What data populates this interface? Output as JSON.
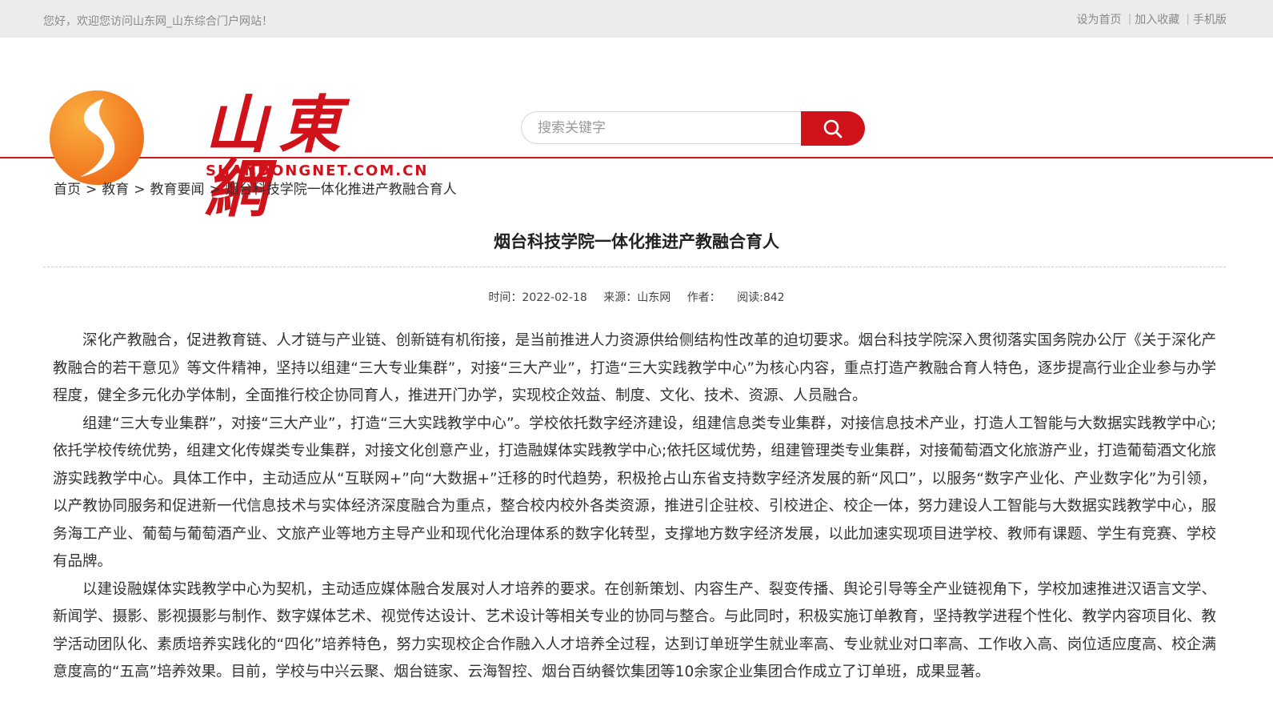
{
  "topbar": {
    "welcome": "您好，欢迎您访问山东网_山东综合门户网站！",
    "links": [
      "设为首页",
      "加入收藏",
      "手机版"
    ]
  },
  "logo": {
    "wordmark": "山東網",
    "domain": "SHANDONGNET.COM.CN",
    "colors": {
      "orange": "#f7941d",
      "red": "#d0121b"
    }
  },
  "search": {
    "placeholder": "搜索关键字",
    "button_icon": "search-icon"
  },
  "breadcrumb": [
    "首页",
    "教育",
    "教育要闻",
    "烟台科技学院一体化推进产教融合育人"
  ],
  "article": {
    "title": "烟台科技学院一体化推进产教融合育人",
    "meta": {
      "time": "时间：2022-02-18",
      "source": "来源：山东网",
      "author": "作者：",
      "reads": "阅读:842"
    },
    "paragraphs": [
      "深化产教融合，促进教育链、人才链与产业链、创新链有机衔接，是当前推进人力资源供给侧结构性改革的迫切要求。烟台科技学院深入贯彻落实国务院办公厅《关于深化产教融合的若干意见》等文件精神，坚持以组建“三大专业集群”，对接“三大产业”，打造“三大实践教学中心”为核心内容，重点打造产教融合育人特色，逐步提高行业企业参与办学程度，健全多元化办学体制，全面推行校企协同育人，推进开门办学，实现校企效益、制度、文化、技术、资源、人员融合。",
      "组建“三大专业集群”，对接“三大产业”，打造“三大实践教学中心”。学校依托数字经济建设，组建信息类专业集群，对接信息技术产业，打造人工智能与大数据实践教学中心;依托学校传统优势，组建文化传媒类专业集群，对接文化创意产业，打造融媒体实践教学中心;依托区域优势，组建管理类专业集群，对接葡萄酒文化旅游产业，打造葡萄酒文化旅游实践教学中心。具体工作中，主动适应从“互联网+”向“大数据+”迁移的时代趋势，积极抢占山东省支持数字经济发展的新“风口”，以服务“数字产业化、产业数字化”为引领，以产教协同服务和促进新一代信息技术与实体经济深度融合为重点，整合校内校外各类资源，推进引企驻校、引校进企、校企一体，努力建设人工智能与大数据实践教学中心，服务海工产业、葡萄与葡萄酒产业、文旅产业等地方主导产业和现代化治理体系的数字化转型，支撑地方数字经济发展，以此加速实现项目进学校、教师有课题、学生有竞赛、学校有品牌。",
      "以建设融媒体实践教学中心为契机，主动适应媒体融合发展对人才培养的要求。在创新策划、内容生产、裂变传播、舆论引导等全产业链视角下，学校加速推进汉语言文学、新闻学、摄影、影视摄影与制作、数字媒体艺术、视觉传达设计、艺术设计等相关专业的协同与整合。与此同时，积极实施订单教育，坚持教学进程个性化、教学内容项目化、教学活动团队化、素质培养实践化的“四化”培养特色，努力实现校企合作融入人才培养全过程，达到订单班学生就业率高、专业就业对口率高、工作收入高、岗位适应度高、校企满意度高的“五高”培养效果。目前，学校与中兴云聚、烟台链家、云海智控、烟台百纳餐饮集团等10余家企业集团合作成立了订单班，成果显著。"
    ]
  }
}
